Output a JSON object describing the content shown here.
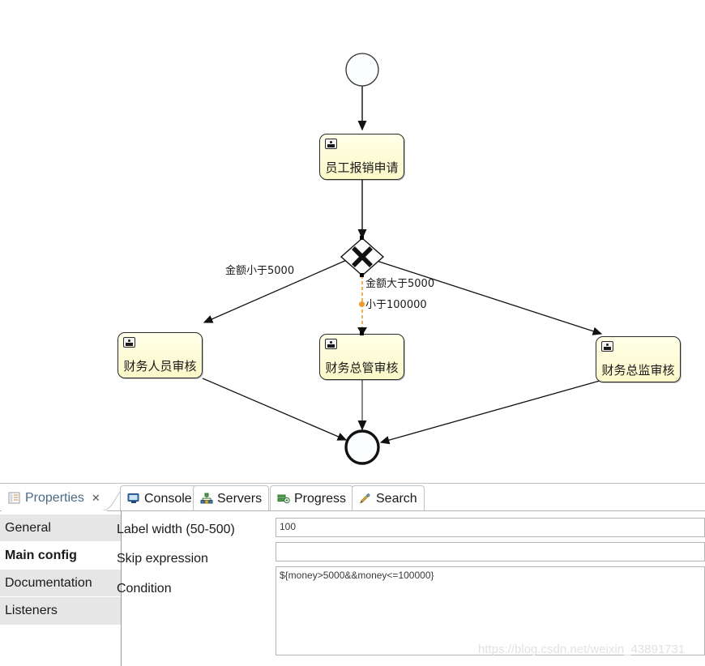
{
  "diagram": {
    "start_event": {
      "name": "start-event"
    },
    "end_event": {
      "name": "end-event"
    },
    "gateway": {
      "name": "exclusive-gateway",
      "symbol": "X"
    },
    "tasks": [
      {
        "id": "task-apply",
        "label": "员工报销申请",
        "icon": "user-task-icon"
      },
      {
        "id": "task-staff",
        "label": "财务人员审核",
        "icon": "user-task-icon"
      },
      {
        "id": "task-manager",
        "label": "财务总管审核",
        "icon": "user-task-icon"
      },
      {
        "id": "task-director",
        "label": "财务总监审核",
        "icon": "user-task-icon"
      }
    ],
    "flow_labels": [
      {
        "id": "flow-left",
        "text": "金额小于5000"
      },
      {
        "id": "flow-mid-1",
        "text": "金额大于5000"
      },
      {
        "id": "flow-mid-2",
        "text": "小于100000"
      }
    ],
    "selected_flow_color": "#f59a23"
  },
  "tabs": [
    {
      "id": "tab-properties",
      "label": "Properties",
      "icon": "properties-icon",
      "active": true,
      "closable": true,
      "close_glyph": "✕"
    },
    {
      "id": "tab-console",
      "label": "Console",
      "icon": "console-icon",
      "active": false,
      "closable": false
    },
    {
      "id": "tab-servers",
      "label": "Servers",
      "icon": "servers-icon",
      "active": false,
      "closable": false
    },
    {
      "id": "tab-progress",
      "label": "Progress",
      "icon": "progress-icon",
      "active": false,
      "closable": false
    },
    {
      "id": "tab-search",
      "label": "Search",
      "icon": "search-icon",
      "active": false,
      "closable": false
    }
  ],
  "sections": [
    {
      "id": "section-general",
      "label": "General",
      "selected": false
    },
    {
      "id": "section-main-config",
      "label": "Main config",
      "selected": true
    },
    {
      "id": "section-documentation",
      "label": "Documentation",
      "selected": false
    },
    {
      "id": "section-listeners",
      "label": "Listeners",
      "selected": false
    }
  ],
  "form": {
    "label_width": {
      "label": "Label width (50-500)",
      "value": "100"
    },
    "skip_expression": {
      "label": "Skip expression",
      "value": ""
    },
    "condition": {
      "label": "Condition",
      "value": "${money>5000&&money<=100000}"
    }
  },
  "watermark": {
    "text": "https://blog.csdn.net/weixin_43891731"
  }
}
